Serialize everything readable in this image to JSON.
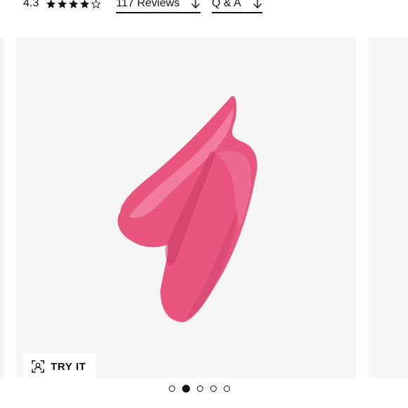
{
  "rating": {
    "value": "4.3",
    "stars": 4.3,
    "max_stars": 5
  },
  "links": {
    "reviews_label": "117 Reviews",
    "qa_label": "Q & A"
  },
  "product": {
    "swatch_color": "#e8567f",
    "swatch_highlight": "#f48aa8",
    "swatch_shadow": "#c93a63"
  },
  "try_it": {
    "label": "TRY IT",
    "icon": "face-scan-icon"
  },
  "carousel": {
    "slide_count": 5,
    "active_index": 1
  }
}
